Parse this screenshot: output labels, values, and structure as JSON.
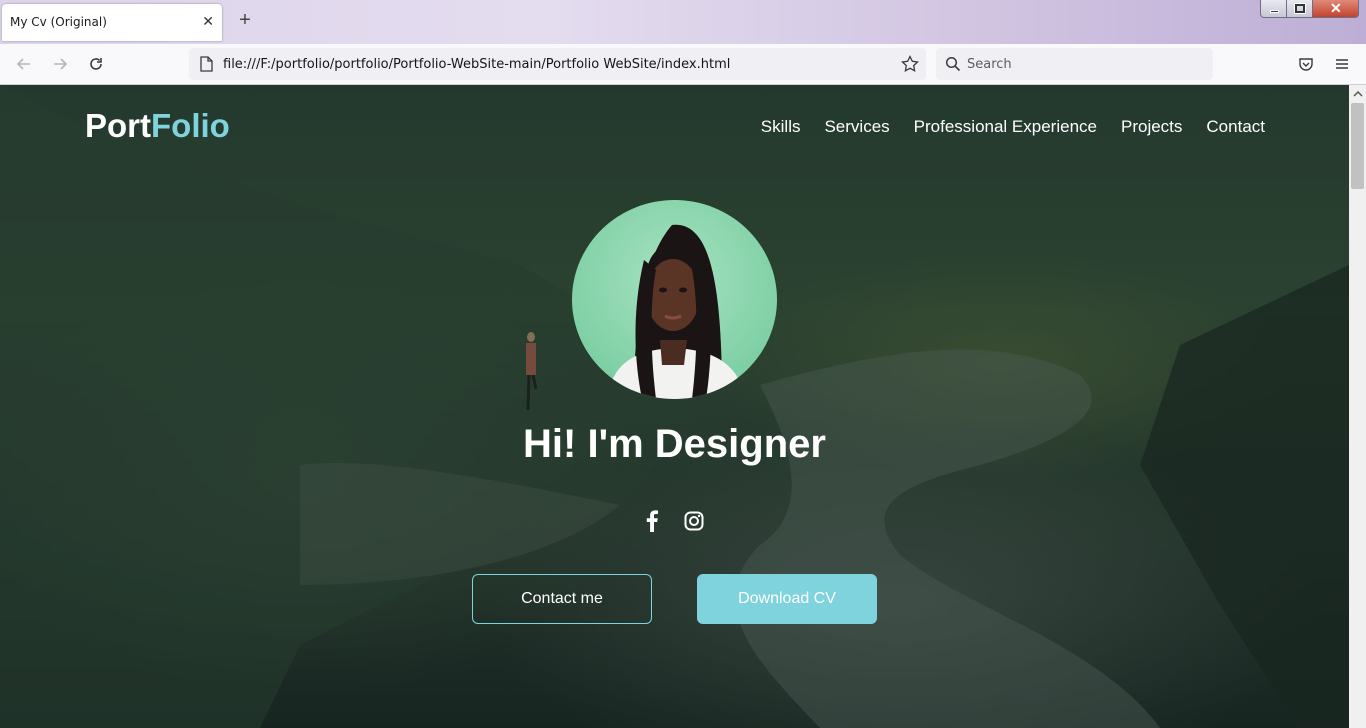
{
  "browser": {
    "tab_title": "My Cv (Original)",
    "tab_close": "✕",
    "new_tab": "+",
    "url": "file:///F:/portfolio/portfolio/Portfolio-WebSite-main/Portfolio WebSite/index.html",
    "search_placeholder": "Search",
    "window_close": "✕"
  },
  "page": {
    "logo": {
      "part1": "Port",
      "part2": "Folio"
    },
    "nav": [
      {
        "label": "Skills"
      },
      {
        "label": "Services"
      },
      {
        "label": "Professional Experience"
      },
      {
        "label": "Projects"
      },
      {
        "label": "Contact"
      }
    ],
    "hero_title": "Hi! I'm Designer",
    "socials": [
      "facebook-icon",
      "instagram-icon"
    ],
    "buttons": {
      "contact": "Contact me",
      "download": "Download CV"
    },
    "colors": {
      "accent": "#7fd3dc",
      "text": "#ffffff"
    }
  }
}
